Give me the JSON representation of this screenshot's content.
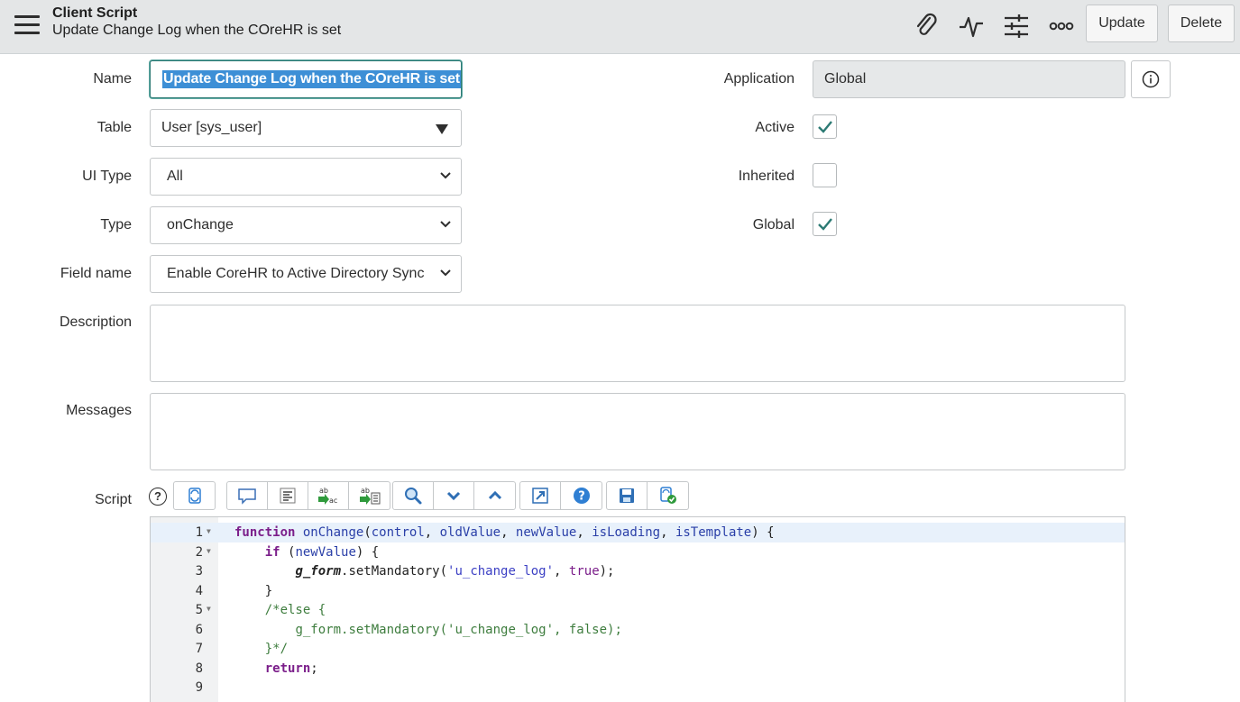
{
  "header": {
    "title": "Client Script",
    "subtitle": "Update Change Log when the COreHR is set",
    "update_label": "Update",
    "delete_label": "Delete"
  },
  "form": {
    "name_label": "Name",
    "name_value": "Update Change Log when the COreHR is set",
    "table_label": "Table",
    "table_value": "User [sys_user]",
    "ui_type_label": "UI Type",
    "ui_type_value": "All",
    "type_label": "Type",
    "type_value": "onChange",
    "field_name_label": "Field name",
    "field_name_value": "Enable CoreHR to Active Directory Sync",
    "description_label": "Description",
    "description_value": "",
    "messages_label": "Messages",
    "messages_value": "",
    "application_label": "Application",
    "application_value": "Global",
    "active_label": "Active",
    "active_checked": true,
    "inherited_label": "Inherited",
    "inherited_checked": false,
    "global_label": "Global",
    "global_checked": true,
    "script_label": "Script"
  },
  "colors": {
    "accent": "#2c7a74",
    "header_bg": "#e4e6e7",
    "selection": "#3d8fd6",
    "toolbar_blue": "#2f7fd3"
  },
  "script": {
    "lines": [
      {
        "n": "1",
        "fold": true
      },
      {
        "n": "2",
        "fold": true
      },
      {
        "n": "3",
        "fold": false
      },
      {
        "n": "4",
        "fold": false
      },
      {
        "n": "5",
        "fold": true
      },
      {
        "n": "6",
        "fold": false
      },
      {
        "n": "7",
        "fold": false
      },
      {
        "n": "8",
        "fold": false
      },
      {
        "n": "9",
        "fold": false
      }
    ],
    "tokens": {
      "l1_kw": "function",
      "l1_fn": "onChange",
      "l1_open": "(",
      "l1_p1": "control",
      "l1_c1": ", ",
      "l1_p2": "oldValue",
      "l1_c2": ", ",
      "l1_p3": "newValue",
      "l1_c3": ", ",
      "l1_p4": "isLoading",
      "l1_c4": ", ",
      "l1_p5": "isTemplate",
      "l1_close": ") {",
      "l2_kw": "if",
      "l2_open": " (",
      "l2_p": "newValue",
      "l2_close": ") {",
      "l3_obj": "g_form",
      "l3_call": ".setMandatory(",
      "l3_str": "'u_change_log'",
      "l3_sep": ", ",
      "l3_bool": "true",
      "l3_end": ");",
      "l4": "}",
      "l5_cm": "/*else {",
      "l6_cm": "g_form.setMandatory('u_change_log', false);",
      "l7_cm": "}*/",
      "l8_kw": "return",
      "l8_end": ";"
    }
  },
  "icons": [
    "menu-icon",
    "paperclip-icon",
    "activity-icon",
    "settings-sliders-icon",
    "more-icon",
    "info-icon",
    "help-icon",
    "script-sync-icon",
    "comment-icon",
    "format-icon",
    "replace-icon",
    "replace-all-icon",
    "search-icon",
    "chevron-down-icon",
    "chevron-up-icon",
    "fullscreen-icon",
    "help-circle-icon",
    "save-icon",
    "validate-icon"
  ]
}
